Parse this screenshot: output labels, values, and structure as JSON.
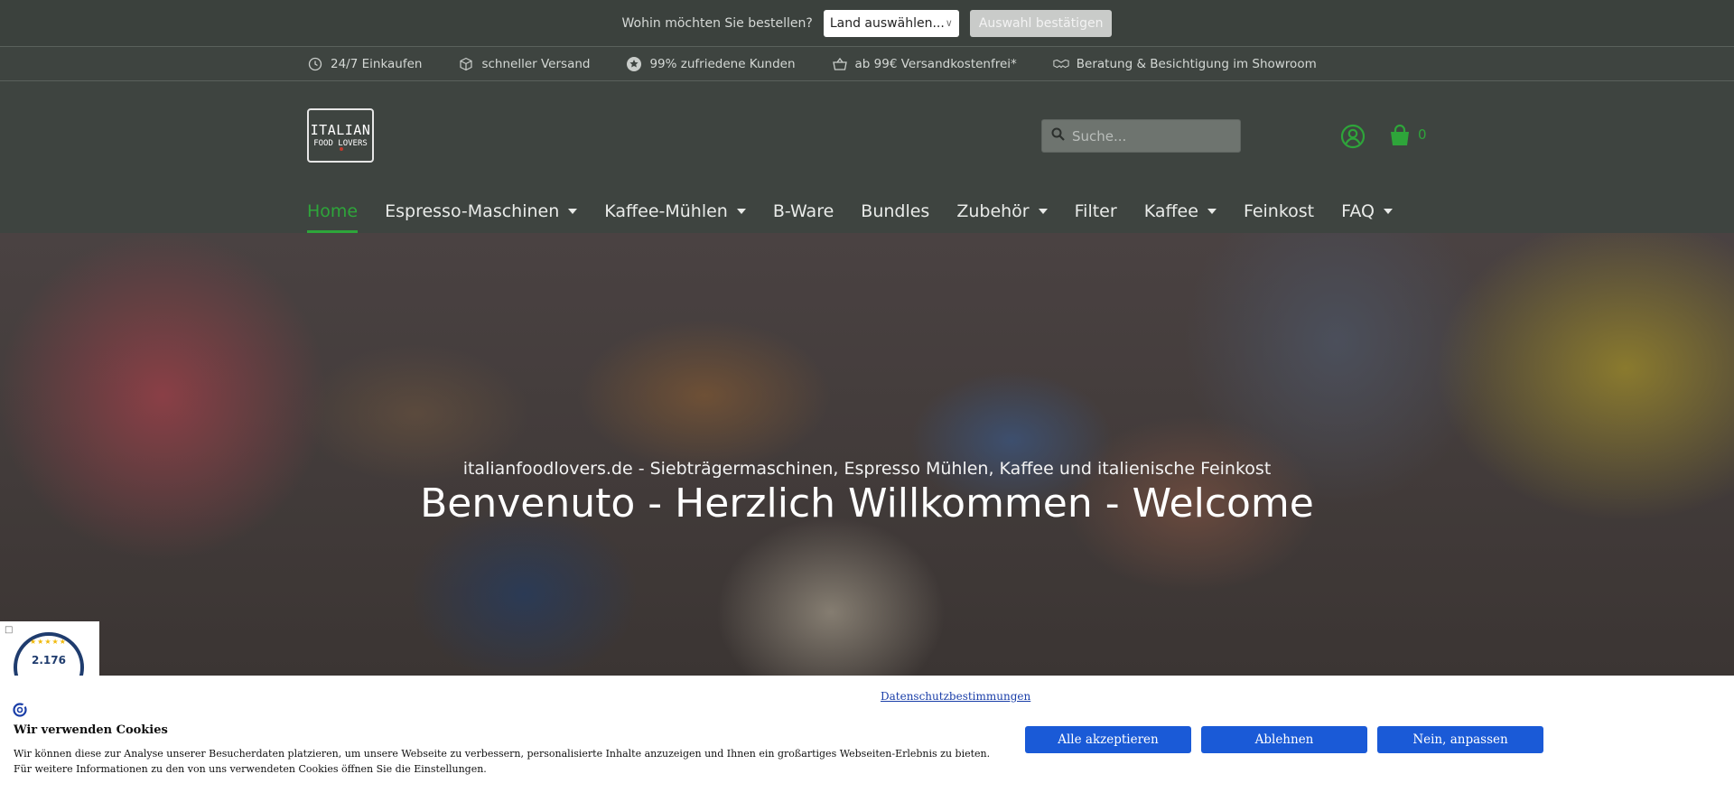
{
  "country_bar": {
    "question": "Wohin möchten Sie bestellen?",
    "select_value": "Land auswählen...",
    "confirm_label": "Auswahl bestätigen"
  },
  "usp": [
    {
      "icon": "clock-icon",
      "label": "24/7 Einkaufen"
    },
    {
      "icon": "box-icon",
      "label": "schneller Versand"
    },
    {
      "icon": "star-badge-icon",
      "label": "99% zufriedene Kunden"
    },
    {
      "icon": "basket-icon",
      "label": "ab 99€ Versandkostenfrei*"
    },
    {
      "icon": "handshake-icon",
      "label": "Beratung & Besichtigung im Showroom"
    }
  ],
  "logo": {
    "line1": "ITALIAN",
    "line2": "FOOD LOVERS"
  },
  "search": {
    "placeholder": "Suche..."
  },
  "cart": {
    "count": "0"
  },
  "nav": [
    {
      "label": "Home",
      "active": true,
      "dropdown": false
    },
    {
      "label": "Espresso-Maschinen",
      "dropdown": true
    },
    {
      "label": "Kaffee-Mühlen",
      "dropdown": true
    },
    {
      "label": "B-Ware",
      "dropdown": false
    },
    {
      "label": "Bundles",
      "dropdown": false
    },
    {
      "label": "Zubehör",
      "dropdown": true
    },
    {
      "label": "Filter",
      "dropdown": false
    },
    {
      "label": "Kaffee",
      "dropdown": true
    },
    {
      "label": "Feinkost",
      "dropdown": false
    },
    {
      "label": "FAQ",
      "dropdown": true
    }
  ],
  "hero": {
    "subtitle": "italianfoodlovers.de - Siebträgermaschinen, Espresso Mühlen, Kaffee und italienische Feinkost",
    "title": "Benvenuto - Herzlich Willkommen - Welcome"
  },
  "trust_badge": {
    "count": "2.176"
  },
  "cookie": {
    "policy_link": "Datenschutzbestimmungen",
    "title": "Wir verwenden Cookies",
    "text": "Wir können diese zur Analyse unserer Besucherdaten platzieren, um unsere Webseite zu verbessern, personalisierte Inhalte anzuzeigen und Ihnen ein großartiges Webseiten-Erlebnis zu bieten. Für weitere Informationen zu den von uns verwendeten Cookies öffnen Sie die Einstellungen.",
    "accept_label": "Alle akzeptieren",
    "reject_label": "Ablehnen",
    "customize_label": "Nein, anpassen"
  },
  "colors": {
    "accent": "#2ea53a",
    "header_bg": "#3e4440",
    "button_blue": "#1a5ad7"
  }
}
